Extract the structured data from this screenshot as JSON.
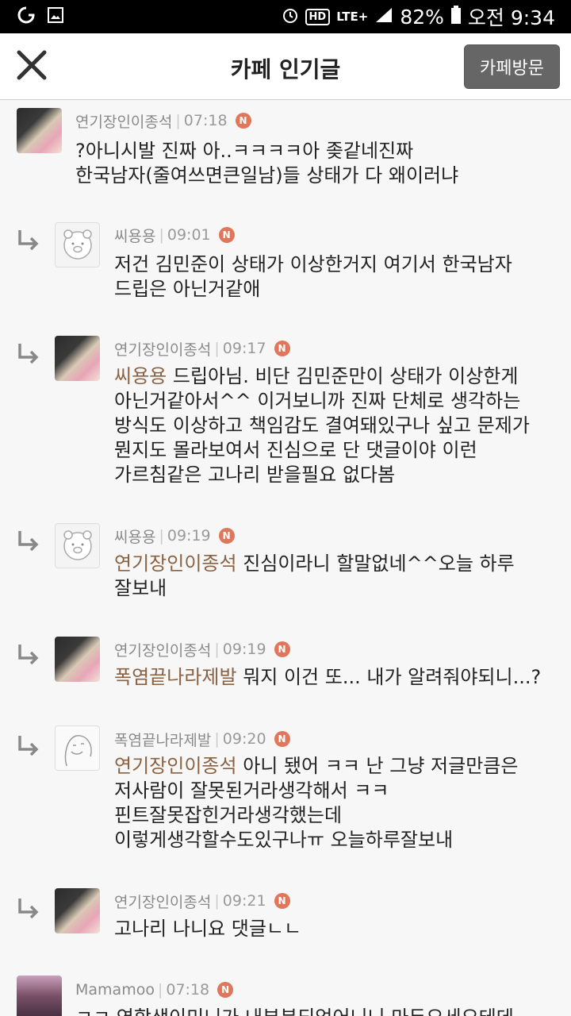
{
  "status_bar": {
    "battery_text": "82%",
    "clock_text": "오전 9:34",
    "network_text": "LTE+",
    "hd_text": "HD"
  },
  "header": {
    "title": "카페 인기글",
    "visit_button": "카페방문"
  },
  "comments": [
    {
      "author": "연기장인이종석",
      "time": "07:18",
      "badge": "N",
      "lines": [
        "?아니시발 진짜 아..ㅋㅋㅋㅋ아 좆같네진짜",
        "한국남자(줄여쓰면큰일남)들 상태가 다 왜이러냐"
      ]
    },
    {
      "author": "씨용용",
      "time": "09:01",
      "badge": "N",
      "lines": [
        "저건 김민준이 상태가 이상한거지 여기서 한국남자",
        "드립은 아닌거같애"
      ]
    },
    {
      "author": "연기장인이종석",
      "time": "09:17",
      "badge": "N",
      "mention": "씨용용",
      "lines": [
        " 드립아님. 비단 김민준만이 상태가 이상한게",
        "아닌거같아서^^ 이거보니까 진짜 단체로 생각하는",
        "방식도 이상하고 책임감도 결여돼있구나 싶고 문제가",
        "뭔지도 몰라보여서 진심으로 단 댓글이야 이런",
        "가르침같은 고나리 받을필요 없다봄"
      ]
    },
    {
      "author": "씨용용",
      "time": "09:19",
      "badge": "N",
      "mention": "연기장인이종석",
      "lines": [
        " 진심이라니 할말없네^^오늘 하루",
        "잘보내"
      ]
    },
    {
      "author": "연기장인이종석",
      "time": "09:19",
      "badge": "N",
      "mention": "폭염끝나라제발",
      "lines": [
        " 뭐지 이건 또... 내가 알려줘야되니...?"
      ]
    },
    {
      "author": "폭염끝나라제발",
      "time": "09:20",
      "badge": "N",
      "mention": "연기장인이종석",
      "lines": [
        " 아니 됐어 ㅋㅋ 난 그냥 저글만큼은",
        "저사람이 잘못된거라생각해서 ㅋㅋ",
        "핀트잘못잡힌거라생각했는데",
        "이렇게생각할수도있구나ㅠ 오늘하루잘보내"
      ]
    },
    {
      "author": "연기장인이종석",
      "time": "09:21",
      "badge": "N",
      "lines": [
        "고나리 나니요 댓글ㄴㄴ"
      ]
    },
    {
      "author": "Mamamoo",
      "time": "07:18",
      "badge": "N",
      "lines": [
        "ㅋㅋ 연합생이미니가 내부분되었어니니 마두요세요테데"
      ]
    }
  ],
  "avatars": {
    "photo": "photo-avatar",
    "kakao": "kakao-character-avatar",
    "sketch": "sketch-character-avatar",
    "mama": "photo-avatar"
  },
  "colors": {
    "badge": "#e0765b",
    "mention": "#8a6242",
    "visit_button_bg": "#666666"
  }
}
